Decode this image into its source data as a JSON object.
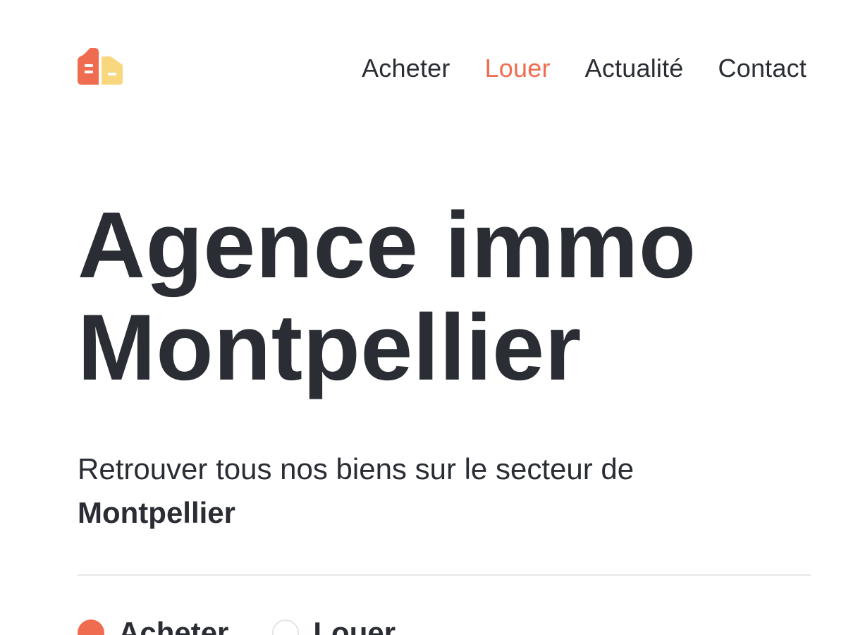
{
  "brand": {
    "logo_name": "agency-logo",
    "colors": {
      "logo_primary": "#ef6c50",
      "logo_secondary": "#f9d77e",
      "accent": "#ef6c50",
      "text": "#2a2d34"
    }
  },
  "nav": {
    "items": [
      {
        "label": "Acheter",
        "active": false
      },
      {
        "label": "Louer",
        "active": true
      },
      {
        "label": "Actualité",
        "active": false
      },
      {
        "label": "Contact",
        "active": false
      }
    ]
  },
  "hero": {
    "title_line_1": "Agence immo",
    "title_line_2": "Montpellier",
    "subtitle_prefix": "Retrouver tous nos biens sur le secteur de",
    "subtitle_emphasis": "Montpellier"
  },
  "search": {
    "transaction_options": [
      {
        "label": "Acheter",
        "selected": true
      },
      {
        "label": "Louer",
        "selected": false
      }
    ]
  }
}
